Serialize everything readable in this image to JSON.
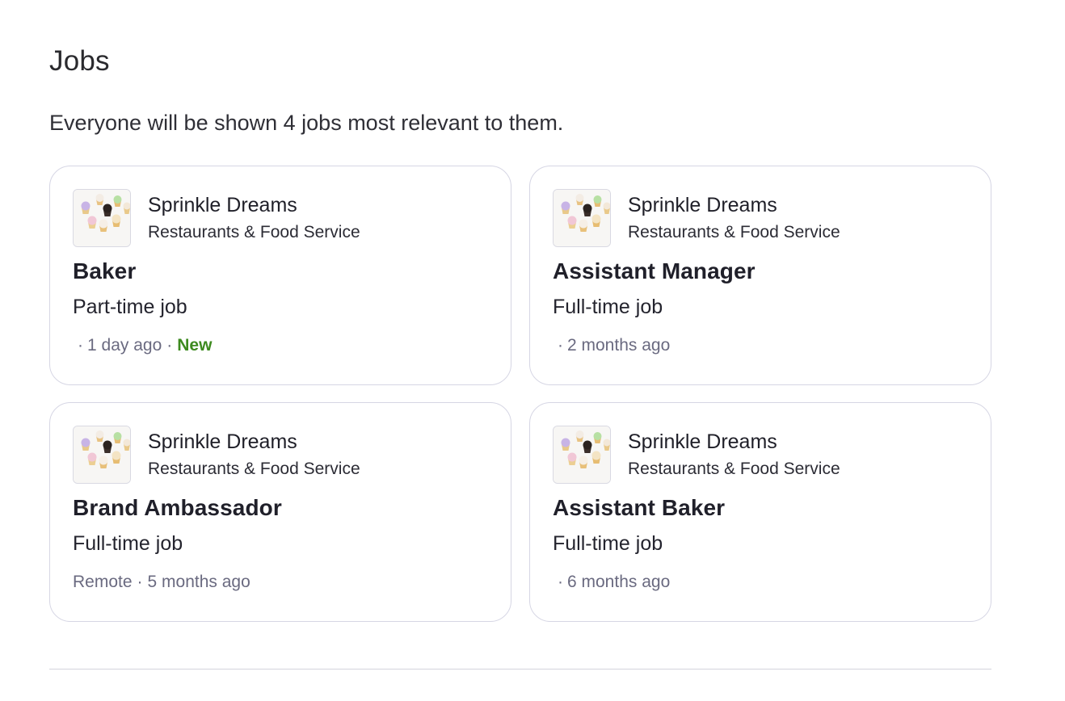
{
  "section": {
    "title": "Jobs",
    "subtitle": "Everyone will be shown 4 jobs most relevant to them."
  },
  "colors": {
    "new_badge": "#3d8a1f",
    "meta_text": "#6a6a80",
    "card_border": "#d6d6e4"
  },
  "jobs": [
    {
      "company": "Sprinkle Dreams",
      "industry": "Restaurants & Food Service",
      "title": "Baker",
      "type": "Part-time job",
      "location": "",
      "separator": "·",
      "posted": "1 day ago",
      "badge": "New"
    },
    {
      "company": "Sprinkle Dreams",
      "industry": "Restaurants & Food Service",
      "title": "Assistant Manager",
      "type": "Full-time job",
      "location": "",
      "separator": "·",
      "posted": "2 months ago",
      "badge": ""
    },
    {
      "company": "Sprinkle Dreams",
      "industry": "Restaurants & Food Service",
      "title": "Brand Ambassador",
      "type": "Full-time job",
      "location": "Remote",
      "separator": "·",
      "posted": "5 months ago",
      "badge": ""
    },
    {
      "company": "Sprinkle Dreams",
      "industry": "Restaurants & Food Service",
      "title": "Assistant Baker",
      "type": "Full-time job",
      "location": "",
      "separator": "·",
      "posted": "6 months ago",
      "badge": ""
    }
  ]
}
